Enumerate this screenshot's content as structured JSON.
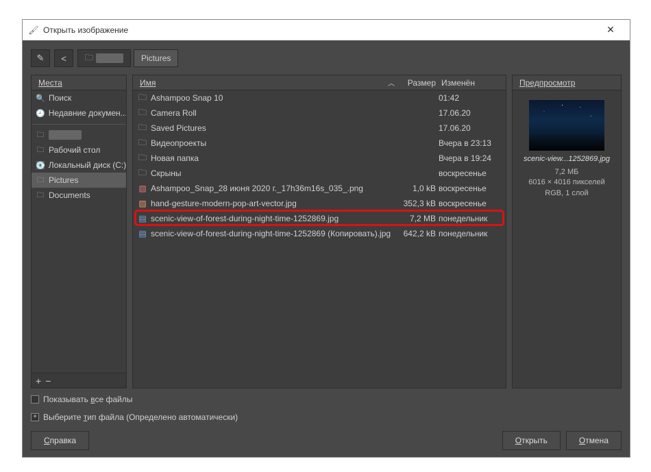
{
  "window": {
    "title": "Открыть изображение"
  },
  "breadcrumbs": {
    "prev_redacted": "",
    "current": "Pictures"
  },
  "places": {
    "header": "Места",
    "items": [
      {
        "label": "Поиск",
        "icon": "🔍"
      },
      {
        "label": "Недавние докумен...",
        "icon": "🕘"
      },
      {
        "label": "",
        "icon": "🗀",
        "redacted": true
      },
      {
        "label": "Рабочий стол",
        "icon": "🗀"
      },
      {
        "label": "Локальный диск (C:)",
        "icon": "💽"
      },
      {
        "label": "Pictures",
        "icon": "🗀",
        "selected": true
      },
      {
        "label": "Documents",
        "icon": "🗀"
      }
    ]
  },
  "columns": {
    "name": "Имя",
    "size": "Размер",
    "modified": "Изменён"
  },
  "files": [
    {
      "type": "folder",
      "name": "Ashampoo Snap 10",
      "size": "",
      "modified": "01:42"
    },
    {
      "type": "folder",
      "name": "Camera Roll",
      "size": "",
      "modified": "17.06.20"
    },
    {
      "type": "folder",
      "name": "Saved Pictures",
      "size": "",
      "modified": "17.06.20"
    },
    {
      "type": "folder",
      "name": "Видеопроекты",
      "size": "",
      "modified": "Вчера в 23:13"
    },
    {
      "type": "folder",
      "name": "Новая папка",
      "size": "",
      "modified": "Вчера в 19:24"
    },
    {
      "type": "folder",
      "name": "Скрыны",
      "size": "",
      "modified": "воскресенье"
    },
    {
      "type": "png",
      "name": "Ashampoo_Snap_28 июня 2020 г._17h36m16s_035_.png",
      "size": "1,0 kB",
      "modified": "воскресенье"
    },
    {
      "type": "jpg",
      "name": "hand-gesture-modern-pop-art-vector.jpg",
      "size": "352,3 kB",
      "modified": "воскресенье"
    },
    {
      "type": "pic",
      "name": "scenic-view-of-forest-during-night-time-1252869.jpg",
      "size": "7,2 MB",
      "modified": "понедельник",
      "highlighted": true
    },
    {
      "type": "pic",
      "name": "scenic-view-of-forest-during-night-time-1252869 (Копировать).jpg",
      "size": "642,2 kB",
      "modified": "понедельник"
    }
  ],
  "preview": {
    "header": "Предпросмотр",
    "filename": "scenic-view...1252869.jpg",
    "size": "7,2 МБ",
    "dimensions": "6016 × 4016 пикселей",
    "mode": "RGB, 1 слой"
  },
  "options": {
    "show_all_pre": "Показывать ",
    "show_all_u": "в",
    "show_all_post": "се файлы",
    "filetype_pre": "Выберите ",
    "filetype_u": "т",
    "filetype_post": "ип файла (Определено автоматически)"
  },
  "buttons": {
    "help_u": "С",
    "help_post": "правка",
    "open_u": "О",
    "open_post": "ткрыть",
    "cancel_u": "О",
    "cancel_post": "тмена"
  }
}
